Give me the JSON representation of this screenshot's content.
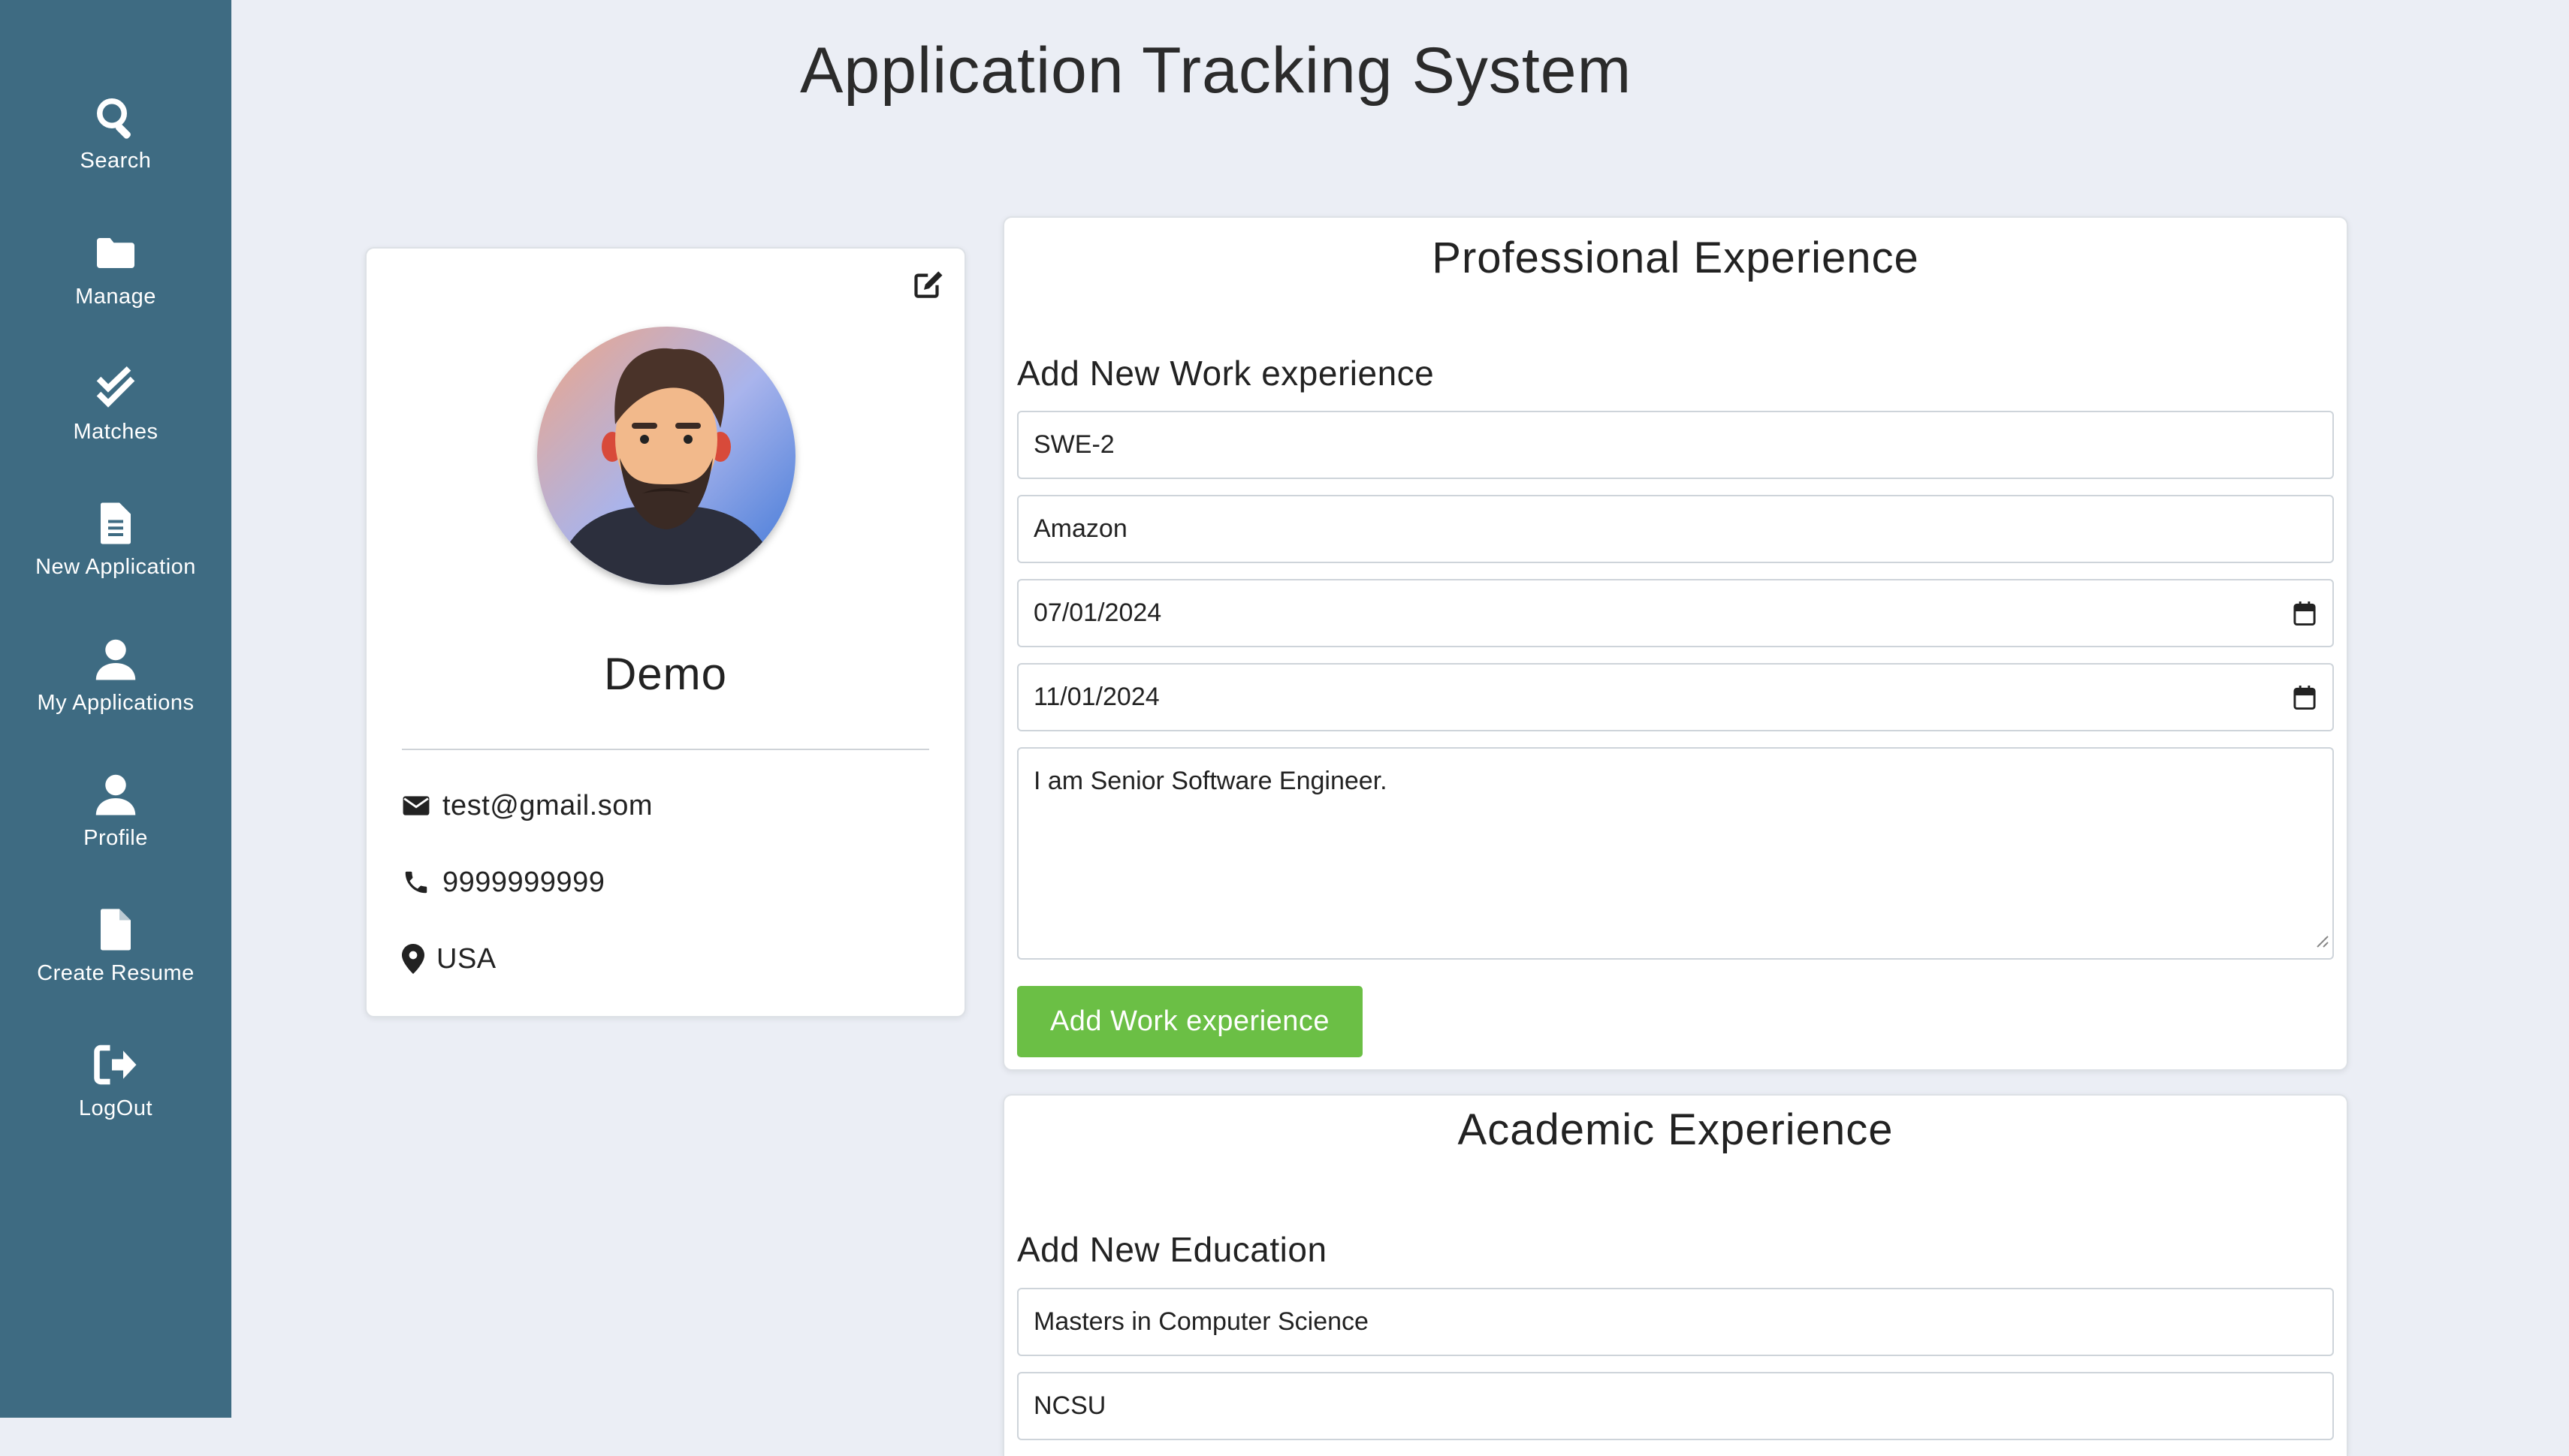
{
  "app": {
    "title": "Application Tracking System"
  },
  "sidebar": {
    "items": [
      {
        "label": "Search",
        "icon": "search-icon"
      },
      {
        "label": "Manage",
        "icon": "folder-icon"
      },
      {
        "label": "Matches",
        "icon": "double-check-icon"
      },
      {
        "label": "New Application",
        "icon": "document-icon"
      },
      {
        "label": "My Applications",
        "icon": "user-icon"
      },
      {
        "label": "Profile",
        "icon": "user-icon"
      },
      {
        "label": "Create Resume",
        "icon": "file-icon"
      },
      {
        "label": "LogOut",
        "icon": "logout-icon"
      }
    ]
  },
  "profile": {
    "name": "Demo",
    "email": "test@gmail.som",
    "phone": "9999999999",
    "location": "USA"
  },
  "professional": {
    "title": "Professional Experience",
    "subtitle": "Add New Work experience",
    "job_title": "SWE-2",
    "company": "Amazon",
    "start_date": "07/01/2024",
    "end_date": "11/01/2024",
    "description": "I am Senior Software Engineer.",
    "add_button": "Add Work experience"
  },
  "academic": {
    "title": "Academic Experience",
    "subtitle": "Add New Education",
    "degree": "Masters in Computer Science",
    "institution": "NCSU"
  },
  "colors": {
    "sidebar": "#3e6b82",
    "background": "#ebeef5",
    "button": "#6bbf45"
  }
}
